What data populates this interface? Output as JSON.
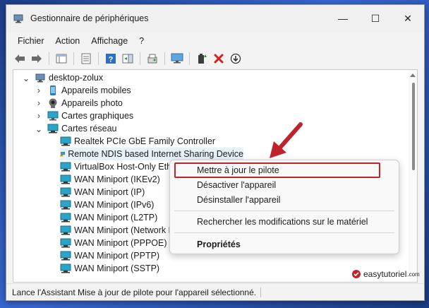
{
  "window": {
    "title": "Gestionnaire de périphériques",
    "controls": {
      "minimize": "—",
      "maximize": "☐",
      "close": "✕"
    }
  },
  "menubar": {
    "items": [
      "Fichier",
      "Action",
      "Affichage",
      "?"
    ]
  },
  "toolbar": {
    "icons": [
      "back-arrow-icon",
      "forward-arrow-icon",
      "properties-panel-icon",
      "list-view-icon",
      "help-icon",
      "action-pane-icon",
      "scan-hardware-icon",
      "monitor-icon",
      "add-driver-icon",
      "uninstall-icon",
      "download-icon"
    ]
  },
  "tree": {
    "root": "desktop-zolux",
    "categories": [
      {
        "label": "Appareils mobiles",
        "expanded": false,
        "icon": "mobile-device-icon"
      },
      {
        "label": "Appareils photo",
        "expanded": false,
        "icon": "camera-icon"
      },
      {
        "label": "Cartes graphiques",
        "expanded": false,
        "icon": "display-adapter-icon"
      },
      {
        "label": "Cartes réseau",
        "expanded": true,
        "icon": "network-adapter-icon"
      }
    ],
    "devices": [
      {
        "label": "Realtek PCIe GbE Family Controller",
        "warning": false
      },
      {
        "label": "Remote NDIS based Internet Sharing Device",
        "warning": true,
        "selected": true
      },
      {
        "label": "VirtualBox Host-Only Ether",
        "warning": false
      },
      {
        "label": "WAN Miniport (IKEv2)",
        "warning": false
      },
      {
        "label": "WAN Miniport (IP)",
        "warning": false
      },
      {
        "label": "WAN Miniport (IPv6)",
        "warning": false
      },
      {
        "label": "WAN Miniport (L2TP)",
        "warning": false
      },
      {
        "label": "WAN Miniport (Network M",
        "warning": false
      },
      {
        "label": "WAN Miniport (PPPOE)",
        "warning": false
      },
      {
        "label": "WAN Miniport (PPTP)",
        "warning": false
      },
      {
        "label": "WAN Miniport (SSTP)",
        "warning": false
      }
    ]
  },
  "context_menu": {
    "update_driver": "Mettre à jour le pilote",
    "disable_device": "Désactiver l'appareil",
    "uninstall_device": "Désinstaller l'appareil",
    "scan_changes": "Rechercher les modifications sur le matériel",
    "properties": "Propriétés"
  },
  "statusbar": {
    "text": "Lance l'Assistant Mise à jour de pilote pour l'appareil sélectionné."
  },
  "watermark": {
    "brand": "easytutoriel",
    "sub": ".com"
  },
  "colors": {
    "highlight_box": "#c0232b",
    "arrow": "#c0232b",
    "selection": "#e5f1fb",
    "network_icon": "#2a7ab8",
    "warning": "#f2b600"
  }
}
